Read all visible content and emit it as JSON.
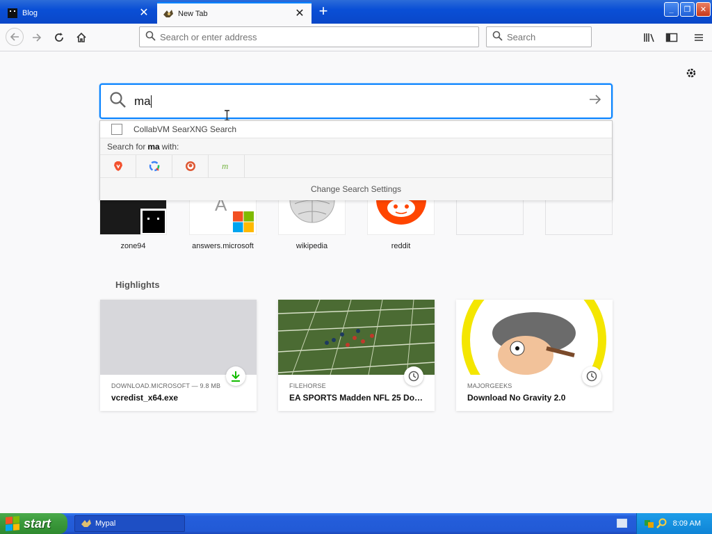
{
  "tabs": [
    {
      "title": "Blog",
      "active": false
    },
    {
      "title": "New Tab",
      "active": true
    }
  ],
  "navbar": {
    "url_placeholder": "Search or enter address",
    "search_placeholder": "Search"
  },
  "search": {
    "query": "ma",
    "suggestion": "CollabVM SearXNG Search",
    "search_for_prefix": "Search for",
    "search_for_term": "ma",
    "search_for_suffix": "with:",
    "engines": [
      "brave-icon",
      "qwant-icon",
      "duckduckgo-icon",
      "mojeek-icon"
    ],
    "change_settings": "Change Search Settings"
  },
  "top_sites": [
    {
      "label": "zone94"
    },
    {
      "label": "answers.microsoft"
    },
    {
      "label": "wikipedia"
    },
    {
      "label": "reddit"
    },
    {
      "label": ""
    },
    {
      "label": ""
    }
  ],
  "highlights": {
    "title": "Highlights",
    "cards": [
      {
        "source": "DOWNLOAD.MICROSOFT — 9.8 MB",
        "title": "vcredist_x64.exe",
        "badge": "download-icon"
      },
      {
        "source": "FILEHORSE",
        "title": "EA SPORTS Madden NFL 25 Dow...",
        "badge": "clock-icon"
      },
      {
        "source": "MAJORGEEKS",
        "title": "Download No Gravity 2.0",
        "badge": "clock-icon"
      }
    ]
  },
  "taskbar": {
    "start_label": "start",
    "task_label": "Mypal",
    "clock": "8:09 AM"
  },
  "colors": {
    "accent": "#0a84ff",
    "titlebar": "#0a4fd6",
    "start_green": "#3c9a3c"
  }
}
